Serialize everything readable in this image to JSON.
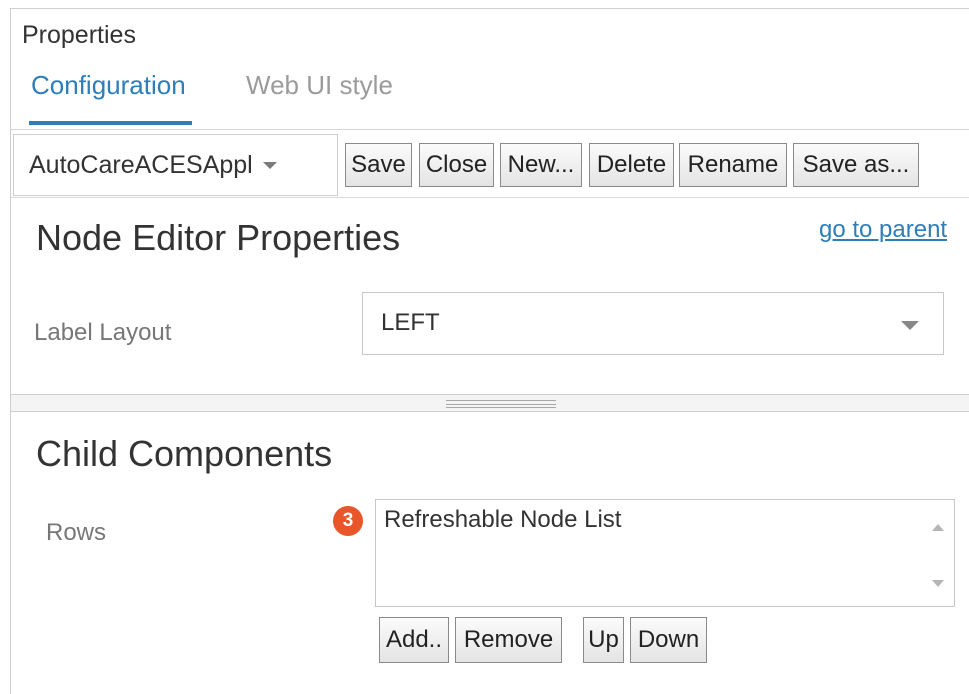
{
  "panel": {
    "title": "Properties"
  },
  "tabs": [
    {
      "label": "Configuration",
      "active": true
    },
    {
      "label": "Web UI style",
      "active": false
    }
  ],
  "toolbar": {
    "config_select": "AutoCareACESAppl",
    "buttons": [
      "Save",
      "Close",
      "New...",
      "Delete",
      "Rename",
      "Save as..."
    ]
  },
  "node_editor": {
    "title": "Node Editor Properties",
    "parent_link": "go to parent",
    "label_layout": {
      "label": "Label Layout",
      "value": "LEFT"
    }
  },
  "child_components": {
    "title": "Child Components",
    "rows_label": "Rows",
    "badge": "3",
    "rows": [
      "Refreshable Node List"
    ],
    "buttons": [
      "Add..",
      "Remove",
      "Up",
      "Down"
    ]
  },
  "colors": {
    "accent": "#2d7eb9",
    "badge": "#e8562a",
    "muted_text": "#777777"
  }
}
